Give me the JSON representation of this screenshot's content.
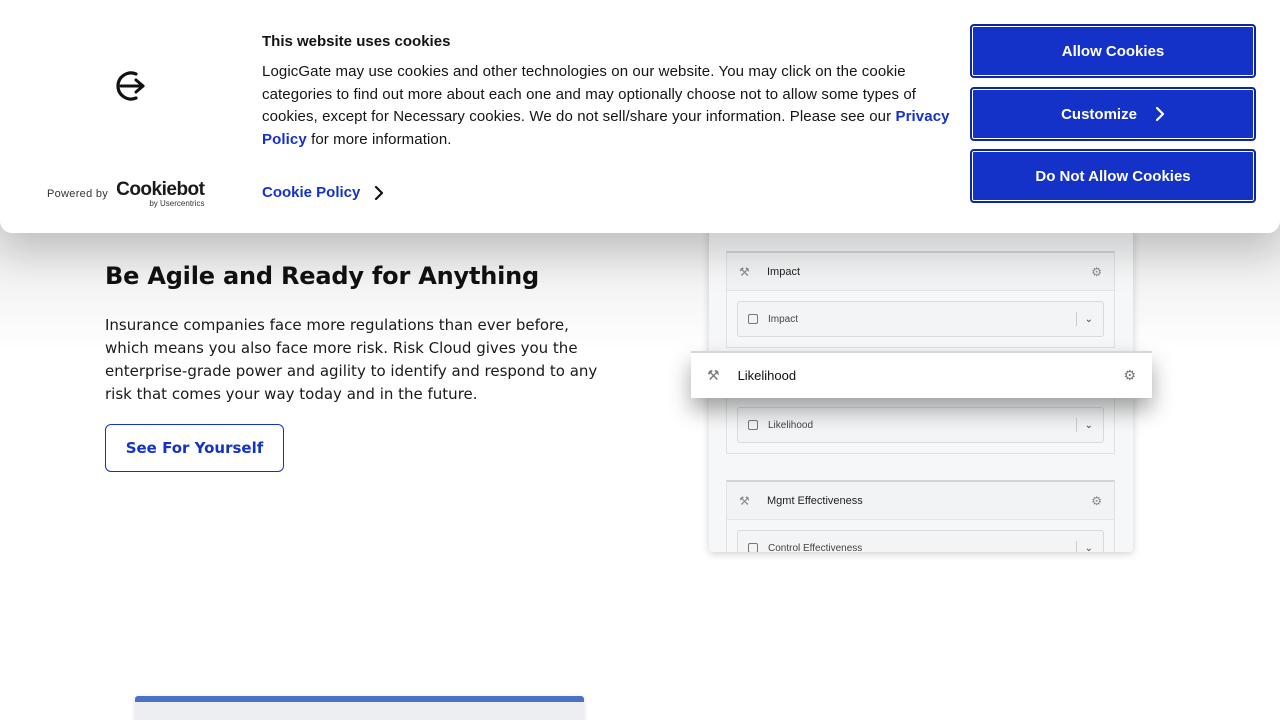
{
  "hero": {
    "title": "Be Agile and Ready for Anything",
    "text": "Insurance companies face more regulations than ever before, which means you also face more risk. Risk Cloud gives you the enterprise-grade power and agility to identify and respond to any risk that comes your way today and in the future.",
    "button": "See For Yourself"
  },
  "mock": {
    "impact_header": "Impact",
    "impact_field": "Impact",
    "likelihood_header": "Likelihood",
    "likelihood_field": "Likelihood",
    "mgmt_header": "Mgmt Effectiveness",
    "control_field": "Control Effectiveness"
  },
  "cookie_banner": {
    "title": "This website uses cookies",
    "text_part1": "LogicGate may use cookies and other technologies on our website. You may click on the cookie categories to find out more about each one and may optionally choose not to allow some types of cookies, except for Necessary cookies.  We do not sell/share your information. Please see our ",
    "privacy_link": "Privacy Policy",
    "text_part2": " for more information.",
    "cookie_policy": "Cookie Policy",
    "powered_by": "Powered by",
    "brand": "Cookiebot",
    "brand_sub": "by Usercentrics",
    "allow": "Allow Cookies",
    "customize": "Customize",
    "deny": "Do Not Allow Cookies"
  },
  "colors": {
    "accent": "#1532c8",
    "bottom_card_bar": "#4a72c2"
  },
  "icons": {
    "logo": "logicgate-logo-icon",
    "chevron": "chevron-right-icon",
    "tool": "hammer-icon",
    "gear": "gear-icon"
  }
}
